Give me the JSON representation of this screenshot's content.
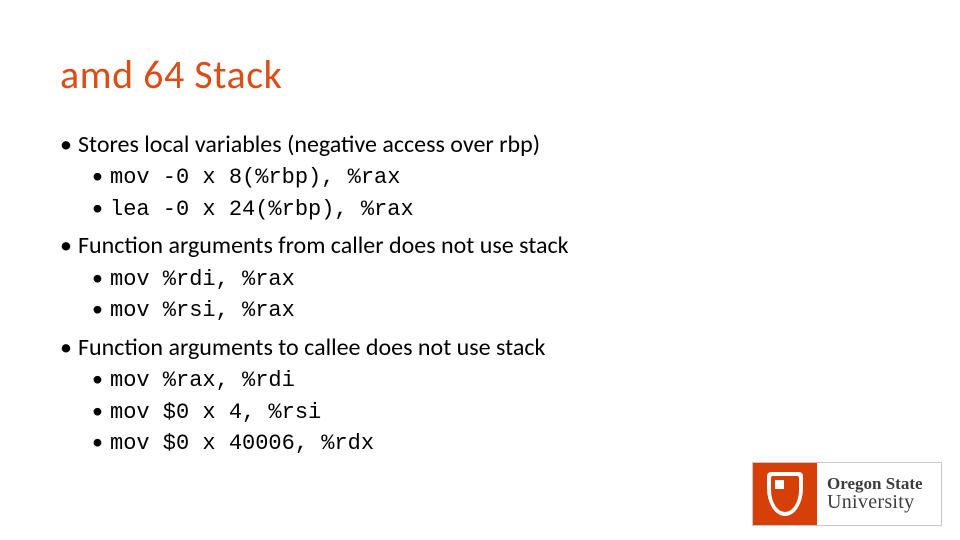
{
  "title": "amd 64 Stack",
  "bullets": [
    {
      "level": 1,
      "text": "Stores local variables (negative access over rbp)"
    },
    {
      "level": 2,
      "text": "mov -0 x 8(%rbp), %rax"
    },
    {
      "level": 2,
      "text": "lea -0 x 24(%rbp), %rax"
    },
    {
      "level": 1,
      "text": "Function arguments from caller does not use stack"
    },
    {
      "level": 2,
      "text": "mov %rdi, %rax"
    },
    {
      "level": 2,
      "text": "mov %rsi, %rax"
    },
    {
      "level": 1,
      "text": "Function arguments to callee does not use stack"
    },
    {
      "level": 2,
      "text": "mov %rax, %rdi"
    },
    {
      "level": 2,
      "text": "mov $0 x 4, %rsi"
    },
    {
      "level": 2,
      "text": "mov $0 x 40006, %rdx"
    }
  ],
  "logo": {
    "line1": "Oregon State",
    "line2": "University"
  }
}
